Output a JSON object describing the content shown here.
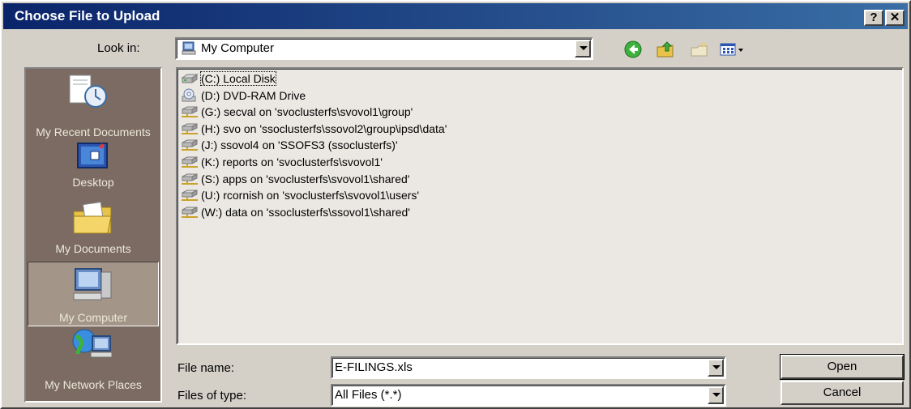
{
  "window": {
    "title": "Choose File to Upload",
    "help_label": "?",
    "close_label": "✕"
  },
  "look_in": {
    "label": "Look in:",
    "value": "My Computer"
  },
  "toolbar": {
    "icons": [
      "back-icon",
      "up-folder-icon",
      "new-folder-icon",
      "views-menu-icon"
    ]
  },
  "places": [
    {
      "id": "recent",
      "label": "My Recent Documents"
    },
    {
      "id": "desktop",
      "label": "Desktop"
    },
    {
      "id": "documents",
      "label": "My Documents"
    },
    {
      "id": "computer",
      "label": "My Computer",
      "selected": true
    },
    {
      "id": "network",
      "label": "My Network Places"
    }
  ],
  "files": [
    {
      "name": "(C:) Local Disk",
      "icon": "hard-disk-icon"
    },
    {
      "name": "(D:) DVD-RAM Drive",
      "icon": "dvd-drive-icon"
    },
    {
      "name": "(G:) secval on 'svoclusterfs\\svovol1\\group'",
      "icon": "network-drive-icon"
    },
    {
      "name": "(H:) svo on 'ssoclusterfs\\ssovol2\\group\\ipsd\\data'",
      "icon": "network-drive-icon"
    },
    {
      "name": "(J:) ssovol4 on 'SSOFS3 (ssoclusterfs)'",
      "icon": "network-drive-icon"
    },
    {
      "name": "(K:) reports on 'svoclusterfs\\svovol1'",
      "icon": "network-drive-icon"
    },
    {
      "name": "(S:) apps on 'svoclusterfs\\svovol1\\shared'",
      "icon": "network-drive-icon"
    },
    {
      "name": "(U:) rcornish on 'svoclusterfs\\svovol1\\users'",
      "icon": "network-drive-icon"
    },
    {
      "name": "(W:) data on 'ssoclusterfs\\ssovol1\\shared'",
      "icon": "network-drive-icon"
    }
  ],
  "file_name": {
    "label": "File name:",
    "value": "E-FILINGS.xls"
  },
  "file_type": {
    "label": "Files of type:",
    "value": "All Files (*.*)"
  },
  "buttons": {
    "open": "Open",
    "cancel": "Cancel"
  },
  "colors": {
    "title_start": "#0a246a",
    "title_end": "#3a6ea5",
    "places_bg": "#7b6b63",
    "list_bg": "#ebe8e3",
    "face": "#d4d0c8"
  }
}
